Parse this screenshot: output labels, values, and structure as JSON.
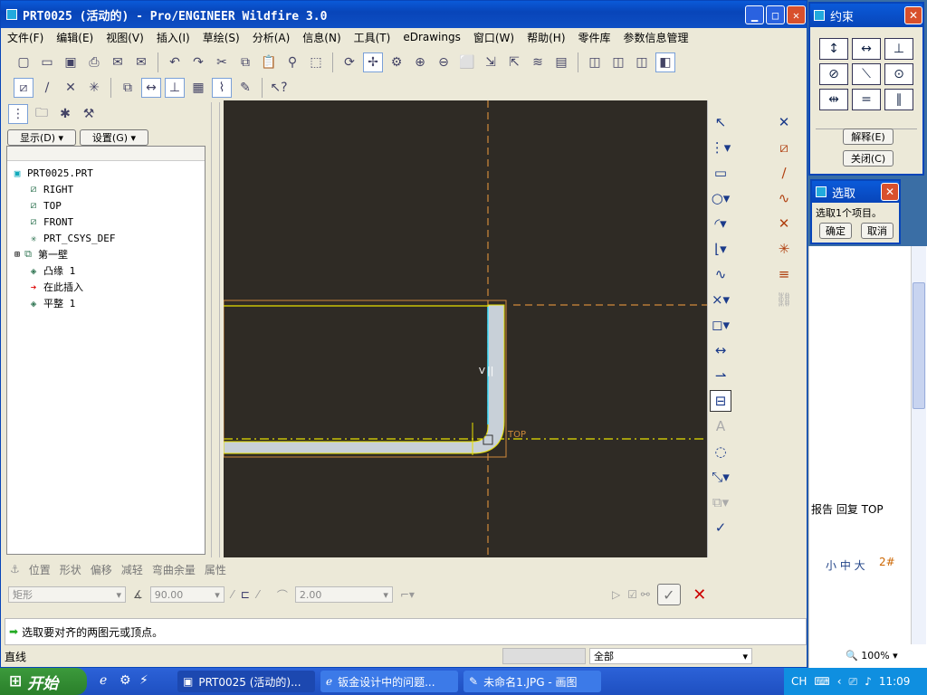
{
  "main_window": {
    "title": "PRT0025 (活动的) - Pro/ENGINEER Wildfire 3.0",
    "menu": [
      "文件(F)",
      "编辑(E)",
      "视图(V)",
      "插入(I)",
      "草绘(S)",
      "分析(A)",
      "信息(N)",
      "工具(T)",
      "eDrawings",
      "窗口(W)",
      "帮助(H)",
      "零件库",
      "参数信息管理"
    ]
  },
  "navigator": {
    "show_label": "显示(D)",
    "settings_label": "设置(G)",
    "tree": [
      {
        "label": "PRT0025.PRT",
        "icon": "part-icon"
      },
      {
        "label": "RIGHT",
        "icon": "datum-plane-icon"
      },
      {
        "label": "TOP",
        "icon": "datum-plane-icon"
      },
      {
        "label": "FRONT",
        "icon": "datum-plane-icon"
      },
      {
        "label": "PRT_CSYS_DEF",
        "icon": "csys-icon"
      },
      {
        "label": "第一壁",
        "icon": "wall-icon"
      },
      {
        "label": "凸缘 1",
        "icon": "flange-icon"
      },
      {
        "label": "在此插入",
        "icon": "insert-arrow-icon"
      },
      {
        "label": "平整 1",
        "icon": "flat-wall-icon"
      }
    ]
  },
  "canvas": {
    "v_label": "V",
    "top_label": "TOP"
  },
  "dashboard": {
    "tabs": [
      "位置",
      "形状",
      "偏移",
      "减轻",
      "弯曲余量",
      "属性"
    ],
    "shape_value": "矩形",
    "angle_value": "90.00",
    "radius_value": "2.00"
  },
  "status": {
    "message": "选取要对齐的两图元或顶点。",
    "mode": "直线",
    "filter": "全部"
  },
  "constraints": {
    "title": "约束",
    "explain_label": "解释(E)",
    "close_label": "关闭(C)"
  },
  "select_dialog": {
    "title": "选取",
    "message": "选取1个项目。",
    "ok_label": "确定",
    "cancel_label": "取消"
  },
  "side_browser": {
    "links": "报告 回复 TOP",
    "font_sizes": "小 中 大",
    "note": "2#",
    "zoom": "100%"
  },
  "taskbar": {
    "start_label": "开始",
    "tasks": [
      "PRT0025 (活动的)...",
      "钣金设计中的问题...",
      "未命名1.JPG - 画图"
    ],
    "tray_lang": "CH",
    "clock": "11:09"
  },
  "colors": {
    "canvas_bg": "#2f2b25",
    "sheet_fill": "#c8d0d8",
    "selection_yellow": "#e8e000",
    "datum_orange": "#d08a3a",
    "title_blue": "#0a5ad9"
  }
}
